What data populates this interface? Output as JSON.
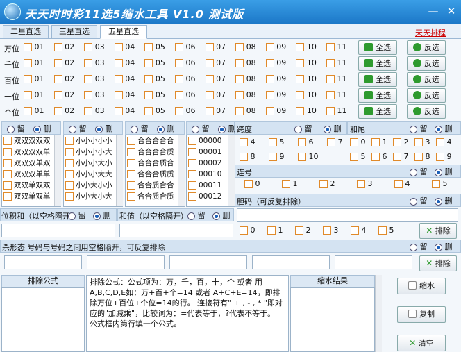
{
  "window": {
    "title": "天天时时彩11选5缩水工具  V1.0  测试版",
    "minimize": "—",
    "close": "✕"
  },
  "tabs": [
    "二星直选",
    "三星直选",
    "五星直选"
  ],
  "top_link": "天天排程",
  "positions": [
    "万位",
    "千位",
    "百位",
    "十位",
    "个位"
  ],
  "numbers": [
    "01",
    "02",
    "03",
    "04",
    "05",
    "06",
    "07",
    "08",
    "09",
    "10",
    "11"
  ],
  "select_all": "全选",
  "invert": "反选",
  "keep": "留",
  "delete": "删",
  "list1": [
    "双双双双双",
    "双双双双单",
    "双双双单双",
    "双双双单单",
    "双双单双双",
    "双双单双单"
  ],
  "list2": [
    "小小小小小",
    "小小小小大",
    "小小小大小",
    "小小小大大",
    "小小大小小",
    "小小大小大"
  ],
  "list3": [
    "合合合合合",
    "合合合合质",
    "合合合质合",
    "合合合质质",
    "合合质合合",
    "合合质合质"
  ],
  "list4": [
    "00000",
    "00001",
    "00002",
    "00010",
    "00011",
    "00012"
  ],
  "span_label": "跨度",
  "span_values": [
    "4",
    "5",
    "6",
    "7",
    "8",
    "9",
    "10"
  ],
  "sum_tail_label": "和尾",
  "sum_tail_values": [
    "0",
    "1",
    "2",
    "3",
    "4",
    "5",
    "6",
    "7",
    "8",
    "9"
  ],
  "consec_label": "连号",
  "consec_values": [
    "0",
    "1",
    "2",
    "3",
    "4",
    "5"
  ],
  "courage_label": "胆码（可反复排除）",
  "courage_values": [
    "0",
    "1",
    "2",
    "3",
    "4",
    "5"
  ],
  "exclude": "排除",
  "posprod_label": "位积和（以空格隔开）",
  "sumval_label": "和值（以空格隔开）",
  "kill_label": "杀形态 号码与号码之间用空格隔开，可反复排除",
  "formula_header": "排除公式",
  "formula_help": "排除公式：公式项为：万，千，百，十，个 或者 用A,B,C,D,E如：万+百+个=14 或者 A+C+E=14，即排除万位+百位+个位=14的行。 连接符有\" + , - , * \"即对应的\"加减乘\"，比较词为：=代表等于，?代表不等于。\n公式框内第行填一个公式。",
  "result_header": "缩水结果",
  "shrink": "缩水",
  "copy": "复制",
  "clear": "清空"
}
